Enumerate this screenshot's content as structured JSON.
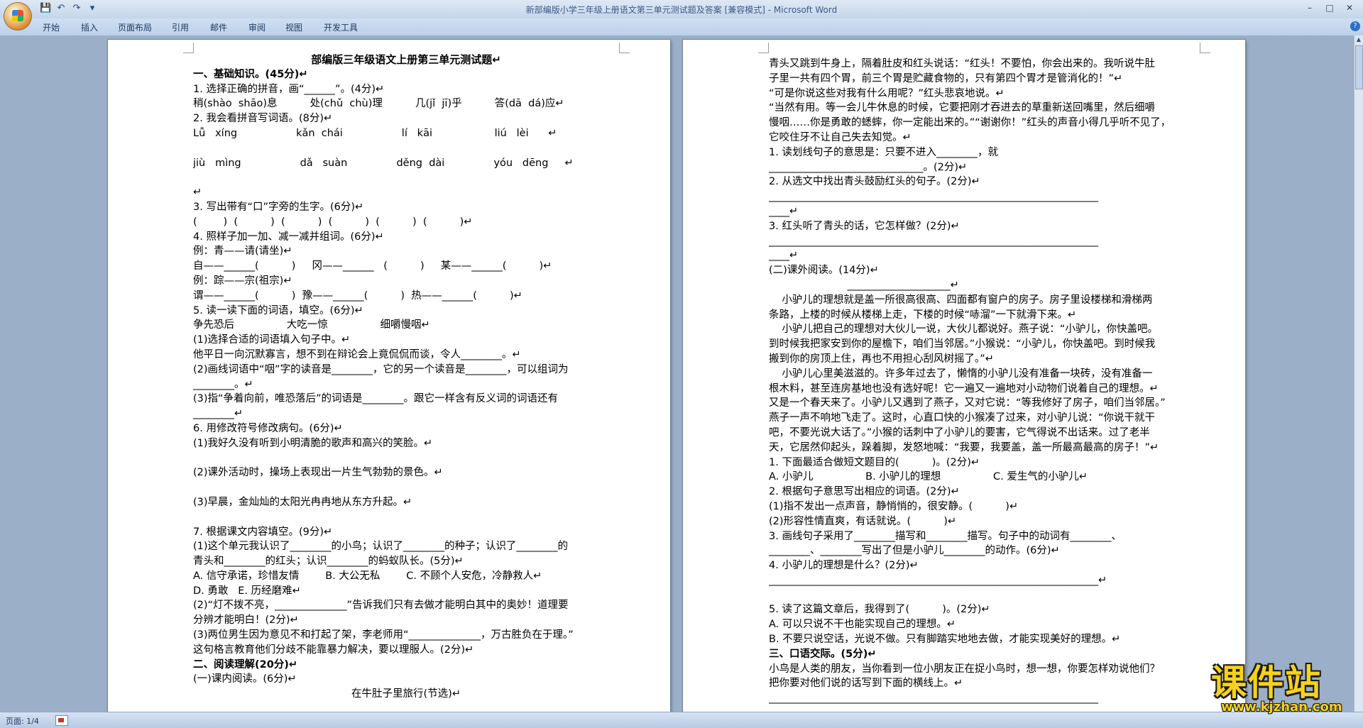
{
  "window": {
    "title": "新部编版小学三年级上册语文第三单元测试题及答案 [兼容模式] - Microsoft Word",
    "controls": [
      "–",
      "□",
      "✕"
    ]
  },
  "qat": {
    "save": "💾",
    "undo": "↶",
    "redo": "↷",
    "customize": "▾"
  },
  "ribbon": {
    "tabs": [
      "开始",
      "插入",
      "页面布局",
      "引用",
      "邮件",
      "审阅",
      "视图",
      "开发工具"
    ],
    "help": "?"
  },
  "left_page": {
    "lines": [
      {
        "t": "部编版三年级语文上册第三单元测试题↵",
        "s": "ttl c"
      },
      {
        "t": "一、基础知识。(45分)↵",
        "s": "b"
      },
      {
        "t": "1. 选择正确的拼音，画“______”。(4分)↵",
        "s": ""
      },
      {
        "t": "稍(shào  shāo)息          处(chǔ  chù)理          几(jǐ  jī)乎          答(dā  dá)应↵",
        "s": ""
      },
      {
        "t": "2. 我会看拼音写词语。(8分)↵",
        "s": ""
      },
      {
        "t": "Lǚ   xíng                  kǎn  chái                  lí   kāi                   liú   lèi      ↵",
        "s": ""
      },
      {
        "t": "",
        "s": ""
      },
      {
        "t": "jiù   mìng                  dǎ   suàn               děng  dài               yóu   dēng     ↵",
        "s": ""
      },
      {
        "t": "",
        "s": ""
      },
      {
        "t": "↵",
        "s": ""
      },
      {
        "t": "3. 写出带有“口”字旁的生字。(6分)↵",
        "s": ""
      },
      {
        "t": "(        )  (          )  (          )  (          )  (          )  (          )↵",
        "s": ""
      },
      {
        "t": "4. 照样子加一加、减一减并组词。(6分)↵",
        "s": ""
      },
      {
        "t": "例：青——请(请坐)↵",
        "s": ""
      },
      {
        "t": "自——______(          )     冈——______   (          )     某——______(          )↵",
        "s": ""
      },
      {
        "t": "例：踪——宗(祖宗)↵",
        "s": ""
      },
      {
        "t": "谓——______(          )  豫——______(          )  热——______(          )↵",
        "s": ""
      },
      {
        "t": "5. 读一读下面的词语，填空。(6分)↵",
        "s": ""
      },
      {
        "t": "争先恐后                大吃一惊                细嚼慢咽↵",
        "s": ""
      },
      {
        "t": "(1)选择合适的词语填入句子中。↵",
        "s": ""
      },
      {
        "t": "他平日一向沉默寡言，想不到在辩论会上竟侃侃而谈，令人________。↵",
        "s": ""
      },
      {
        "t": "(2)画线词语中“咽”字的读音是________，它的另一个读音是________，可以组词为",
        "s": ""
      },
      {
        "t": "________。↵",
        "s": ""
      },
      {
        "t": "(3)指“争着向前，唯恐落后”的词语是________。跟它一样含有反义词的词语还有",
        "s": ""
      },
      {
        "t": "________↵",
        "s": ""
      },
      {
        "t": "6. 用修改符号修改病句。(6分)↵",
        "s": ""
      },
      {
        "t": "(1)我好久没有听到小明清脆的歌声和高兴的笑脸。↵",
        "s": ""
      },
      {
        "t": "",
        "s": ""
      },
      {
        "t": "(2)课外活动时，操场上表现出一片生气勃勃的景色。↵",
        "s": ""
      },
      {
        "t": "",
        "s": ""
      },
      {
        "t": "(3)早晨，金灿灿的太阳光冉冉地从东方升起。↵",
        "s": ""
      },
      {
        "t": "",
        "s": ""
      },
      {
        "t": "7. 根据课文内容填空。(9分)↵",
        "s": ""
      },
      {
        "t": "(1)这个单元我认识了________的小鸟；认识了________的种子；认识了________的",
        "s": ""
      },
      {
        "t": "青头和________的红头；认识________的蚂蚁队长。(5分)↵",
        "s": ""
      },
      {
        "t": "A. 信守承诺，珍惜友情        B. 大公无私        C. 不顾个人安危，冷静救人↵",
        "s": ""
      },
      {
        "t": "D. 勇敢   E. 历经磨难↵",
        "s": ""
      },
      {
        "t": "(2)“灯不拨不亮，______________”告诉我们只有去做才能明白其中的奥妙！道理要",
        "s": ""
      },
      {
        "t": "分辨才能明白！(2分)↵",
        "s": ""
      },
      {
        "t": "(3)两位男生因为意见不和打起了架，李老师用“______________，万古胜负在于理。”",
        "s": ""
      },
      {
        "t": "这句格言教育他们分歧不能靠暴力解决，要以理服人。(2分)↵",
        "s": ""
      },
      {
        "t": "二、阅读理解(20分)↵",
        "s": "b"
      },
      {
        "t": "(一)课内阅读。(6分)↵",
        "s": ""
      },
      {
        "t": "在牛肚子里旅行(节选)↵",
        "s": "c"
      }
    ]
  },
  "right_page": {
    "lines": [
      {
        "t": "青头又跳到牛身上，隔着肚皮和红头说话：“红头！不要怕，你会出来的。我听说牛肚",
        "s": ""
      },
      {
        "t": "子里一共有四个胃，前三个胃是贮藏食物的，只有第四个胃才是管消化的！”↵",
        "s": ""
      },
      {
        "t": "“可是你说这些对我有什么用呢？”红头悲哀地说。↵",
        "s": ""
      },
      {
        "t": "“当然有用。等一会儿牛休息的时候，它要把刚才吞进去的草重新送回嘴里，然后细嚼",
        "s": ""
      },
      {
        "t": "慢咽……你是勇敢的蟋蟀，你一定能出来的。”“谢谢你！”红头的声音小得几乎听不见了，",
        "s": ""
      },
      {
        "t": "它咬住牙不让自己失去知觉。↵",
        "s": ""
      },
      {
        "t": "1. 读划线句子的意思是：只要不进入________，就",
        "s": ""
      },
      {
        "t": "______________________________。(2分)↵",
        "s": ""
      },
      {
        "t": "2. 从选文中找出青头鼓励红头的句子。(2分)↵",
        "s": ""
      },
      {
        "t": "________________________________________________________________",
        "s": ""
      },
      {
        "t": "____↵",
        "s": ""
      },
      {
        "t": "3. 红头听了青头的话，它怎样做？(2分)↵",
        "s": ""
      },
      {
        "t": "________________________________________________________________",
        "s": ""
      },
      {
        "t": "____↵",
        "s": ""
      },
      {
        "t": "(二)课外阅读。(14分)↵",
        "s": ""
      },
      {
        "t": "                        ____________________↵",
        "s": ""
      },
      {
        "t": "    小驴儿的理想就是盖一所很高很高、四面都有窗户的房子。房子里设楼梯和滑梯两",
        "s": ""
      },
      {
        "t": "条路，上楼的时候从楼梯上走，下楼的时候“哧溜”一下就滑下来。↵",
        "s": ""
      },
      {
        "t": "    小驴儿把自己的理想对大伙儿一说，大伙儿都说好。燕子说：“小驴儿，你快盖吧。",
        "s": ""
      },
      {
        "t": "到时候我把家安到你的屋檐下，咱们当邻居。”小猴说：“小驴儿，你快盖吧。到时候我",
        "s": ""
      },
      {
        "t": "搬到你的房顶上住，再也不用担心刮风树摇了。”↵",
        "s": ""
      },
      {
        "t": "    小驴儿心里美滋滋的。许多年过去了，懒惰的小驴儿没有准备一块砖，没有准备一",
        "s": ""
      },
      {
        "t": "根木料，甚至连房基地也没有选好呢！它一遍又一遍地对小动物们说着自己的理想。↵",
        "s": ""
      },
      {
        "t": "又是一个春天来了。小驴儿又遇到了燕子，又对它说：“等我修好了房子，咱们当邻居。”",
        "s": ""
      },
      {
        "t": "燕子一声不响地飞走了。这时，心直口快的小猴凑了过来，对小驴儿说：“你说干就干",
        "s": ""
      },
      {
        "t": "吧，不要光说大话了。”小猴的话刺中了小驴儿的要害，它气得说不出话来。过了老半",
        "s": ""
      },
      {
        "t": "天，它居然仰起头，跺着脚，发怒地喊：“我要，我要盖，盖一所最高最高的房子！”↵",
        "s": ""
      },
      {
        "t": "1. 下面最适合做短文题目的(          )。(2分)↵",
        "s": ""
      },
      {
        "t": "A. 小驴儿                B. 小驴儿的理想                C. 爱生气的小驴儿↵",
        "s": ""
      },
      {
        "t": "2. 根据句子意思写出相应的词语。(2分)↵",
        "s": ""
      },
      {
        "t": "(1)指不发出一点声音，静悄悄的，很安静。(          )↵",
        "s": ""
      },
      {
        "t": "(2)形容性情直爽，有话就说。(          )↵",
        "s": ""
      },
      {
        "t": "3. 画线句子采用了________描写和________描写。句子中的动词有________、",
        "s": ""
      },
      {
        "t": "________、________写出了但是小驴儿________的动作。(6分)↵",
        "s": ""
      },
      {
        "t": "4. 小驴儿的理想是什么？(2分)↵",
        "s": ""
      },
      {
        "t": "________________________________________________________________↵",
        "s": ""
      },
      {
        "t": "",
        "s": ""
      },
      {
        "t": "5. 读了这篇文章后，我得到了(          )。(2分)↵",
        "s": ""
      },
      {
        "t": "A. 可以只说不干也能实现自己的理想。↵",
        "s": ""
      },
      {
        "t": "B. 不要只说空话，光说不做。只有脚踏实地地去做，才能实现美好的理想。↵",
        "s": ""
      },
      {
        "t": "三、口语交际。(5分)↵",
        "s": "b"
      },
      {
        "t": "小鸟是人类的朋友，当你看到一位小朋友正在捉小鸟时，想一想，你要怎样劝说他们？",
        "s": ""
      },
      {
        "t": "把你要对他们说的话写到下面的横线上。↵",
        "s": ""
      },
      {
        "t": "________________________________________________________________",
        "s": ""
      },
      {
        "t": "________________________________________________________________",
        "s": ""
      }
    ]
  },
  "status": {
    "page": "页面: 1/4"
  },
  "watermark": {
    "big": "课件站",
    "small": "www.kjzhan.com"
  }
}
